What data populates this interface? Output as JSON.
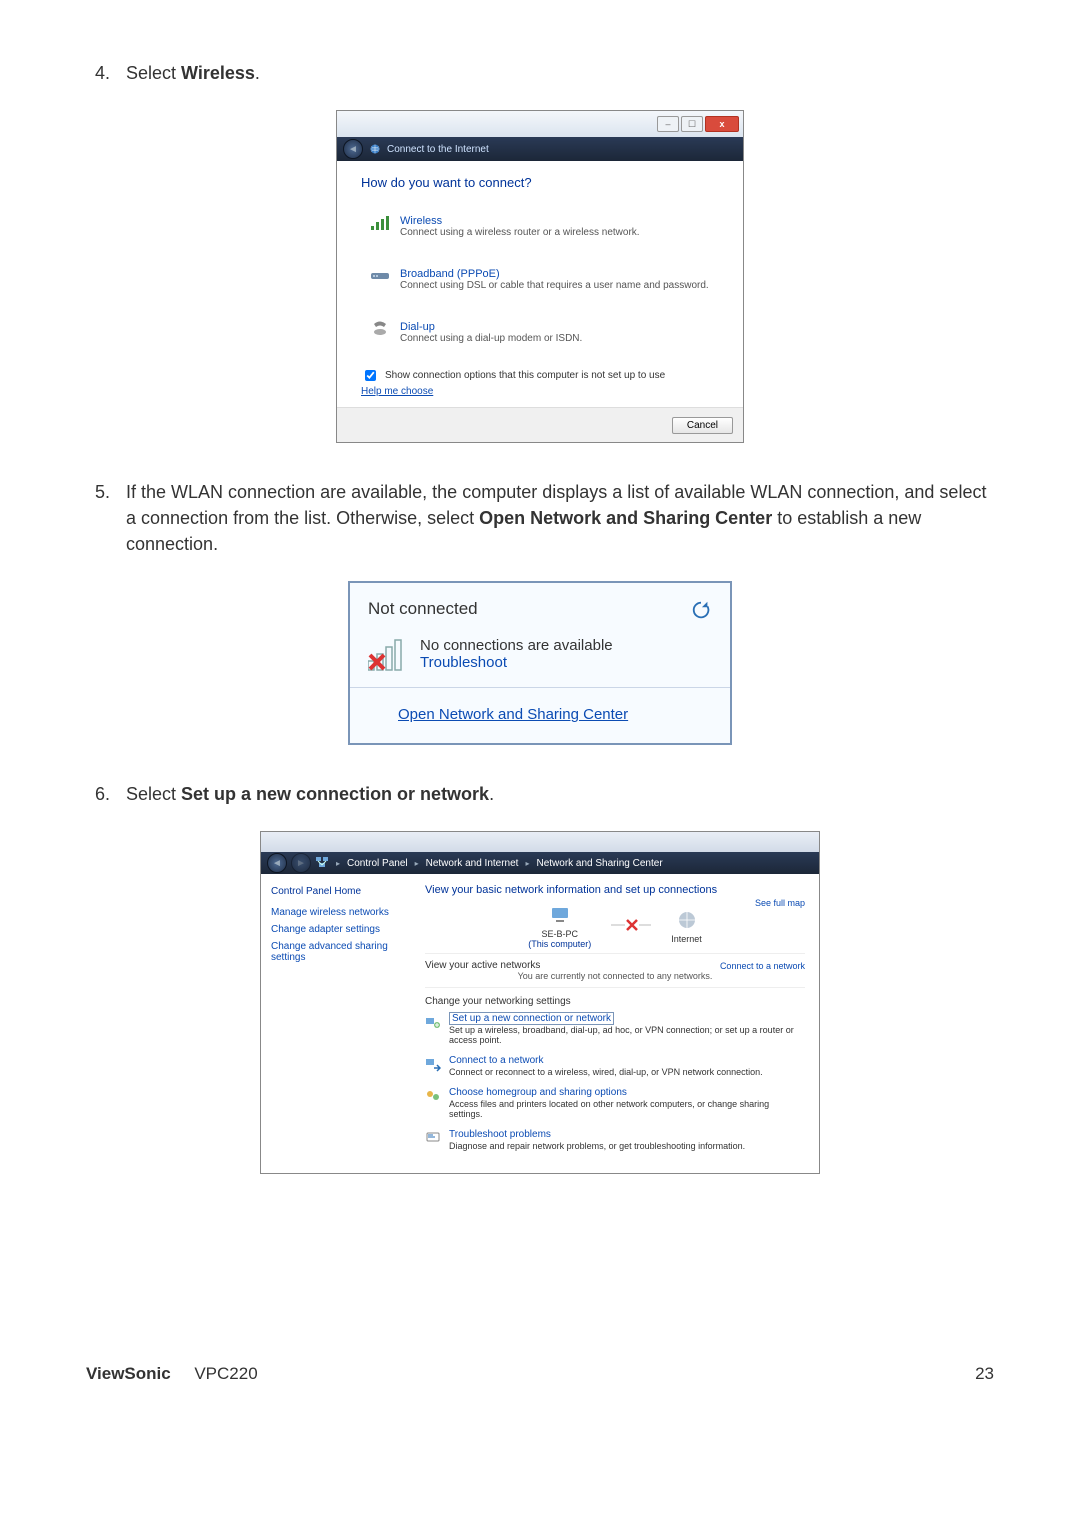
{
  "steps": {
    "s4": {
      "num": "4.",
      "pre": "Select ",
      "bold": "Wireless",
      "post": "."
    },
    "s5": {
      "num": "5.",
      "pre": "If the WLAN connection are available, the computer displays a list of available WLAN connection, and select a connection from the list. Otherwise, select ",
      "bold": "Open Network and Sharing Center",
      "post": " to establish a new connection."
    },
    "s6": {
      "num": "6.",
      "pre": "Select ",
      "bold": "Set up a new connection or network",
      "post": "."
    }
  },
  "dlg1": {
    "title": "Connect to the Internet",
    "heading": "How do you want to connect?",
    "opts": [
      {
        "title": "Wireless",
        "sub": "Connect using a wireless router or a wireless network."
      },
      {
        "title": "Broadband (PPPoE)",
        "sub": "Connect using DSL or cable that requires a user name and password."
      },
      {
        "title": "Dial-up",
        "sub": "Connect using a dial-up modem or ISDN."
      }
    ],
    "checkbox": "Show connection options that this computer is not set up to use",
    "help": "Help me choose",
    "cancel": "Cancel"
  },
  "flyout": {
    "title": "Not connected",
    "noconn": "No connections are available",
    "troubleshoot": "Troubleshoot",
    "open": "Open Network and Sharing Center"
  },
  "nsc": {
    "crumbs": [
      "Control Panel",
      "Network and Internet",
      "Network and Sharing Center"
    ],
    "sidebar": {
      "cph": "Control Panel Home",
      "links": [
        "Manage wireless networks",
        "Change adapter settings",
        "Change advanced sharing settings"
      ]
    },
    "heading1": "View your basic network information and set up connections",
    "seefull": "See full map",
    "node1": {
      "label": "SE-B-PC",
      "sub": "(This computer)"
    },
    "node2": {
      "label": "Internet"
    },
    "active_label": "View your active networks",
    "connect_link": "Connect to a network",
    "active_sub": "You are currently not connected to any networks.",
    "heading2": "Change your networking settings",
    "tasks": [
      {
        "title": "Set up a new connection or network",
        "sub": "Set up a wireless, broadband, dial-up, ad hoc, or VPN connection; or set up a router or access point.",
        "boxed": true
      },
      {
        "title": "Connect to a network",
        "sub": "Connect or reconnect to a wireless, wired, dial-up, or VPN network connection."
      },
      {
        "title": "Choose homegroup and sharing options",
        "sub": "Access files and printers located on other network computers, or change sharing settings."
      },
      {
        "title": "Troubleshoot problems",
        "sub": "Diagnose and repair network problems, or get troubleshooting information."
      }
    ]
  },
  "footer": {
    "brand": "ViewSonic",
    "model": "VPC220",
    "page": "23"
  }
}
